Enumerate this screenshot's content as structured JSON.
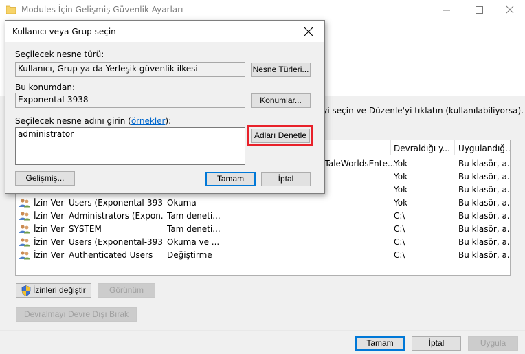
{
  "background_window": {
    "title": "Modules İçin Gelişmiş Güvenlik Ayarları",
    "instruction": "'yi seçin ve Düzenle'yi tıklatın (kullanılabiliyorsa).",
    "columns": {
      "inherited_from": "Devraldığı y...",
      "applies_to": "Uygulandığ..."
    },
    "rows": [
      {
        "type": "",
        "principal": "\"TaleWorldsEnte...",
        "access": "",
        "inherited": "Yok",
        "applies": "Bu klasör, a...",
        "icon": false
      },
      {
        "type": "",
        "principal": "",
        "access": "",
        "inherited": "Yok",
        "applies": "Bu klasör, a...",
        "icon": false
      },
      {
        "type": "",
        "principal": "",
        "access": "",
        "inherited": "Yok",
        "applies": "Bu klasör, a...",
        "icon": false
      },
      {
        "type": "İzin Ver",
        "principal": "Users (Exponental-393...",
        "access": "Okuma",
        "inherited": "Yok",
        "applies": "Bu klasör, a...",
        "icon": true
      },
      {
        "type": "İzin Ver",
        "principal": "Administrators (Expon...",
        "access": "Tam deneti...",
        "inherited": "C:\\",
        "applies": "Bu klasör, a...",
        "icon": true
      },
      {
        "type": "İzin Ver",
        "principal": "SYSTEM",
        "access": "Tam deneti...",
        "inherited": "C:\\",
        "applies": "Bu klasör, a...",
        "icon": true
      },
      {
        "type": "İzin Ver",
        "principal": "Users (Exponental-393...",
        "access": "Okuma ve ...",
        "inherited": "C:\\",
        "applies": "Bu klasör, a...",
        "icon": true
      },
      {
        "type": "İzin Ver",
        "principal": "Authenticated Users",
        "access": "Değiştirme",
        "inherited": "C:\\",
        "applies": "Bu klasör, a...",
        "icon": true
      }
    ],
    "buttons": {
      "change_permissions": "İzinleri değiştir",
      "view": "Görünüm",
      "disable_inheritance": "Devralmayı Devre Dışı Bırak",
      "ok": "Tamam",
      "cancel": "İptal",
      "apply": "Uygula"
    }
  },
  "dialog": {
    "title": "Kullanıcı veya Grup seçin",
    "object_type_label": "Seçilecek nesne türü:",
    "object_type_value": "Kullanıcı, Grup ya da Yerleşik güvenlik ilkesi",
    "object_types_button": "Nesne Türleri...",
    "location_label": "Bu konumdan:",
    "location_value": "Exponental-3938",
    "locations_button": "Konumlar...",
    "names_label_prefix": "Seçilecek nesne adını girin (",
    "names_label_link": "örnekler",
    "names_label_suffix": "):",
    "names_value": "administrator",
    "check_names_button": "Adları Denetle",
    "advanced_button": "Gelişmiş...",
    "ok_button": "Tamam",
    "cancel_button": "İptal"
  },
  "colors": {
    "highlight": "#e8212a",
    "focus_border": "#0078d7",
    "link": "#0066cc"
  }
}
